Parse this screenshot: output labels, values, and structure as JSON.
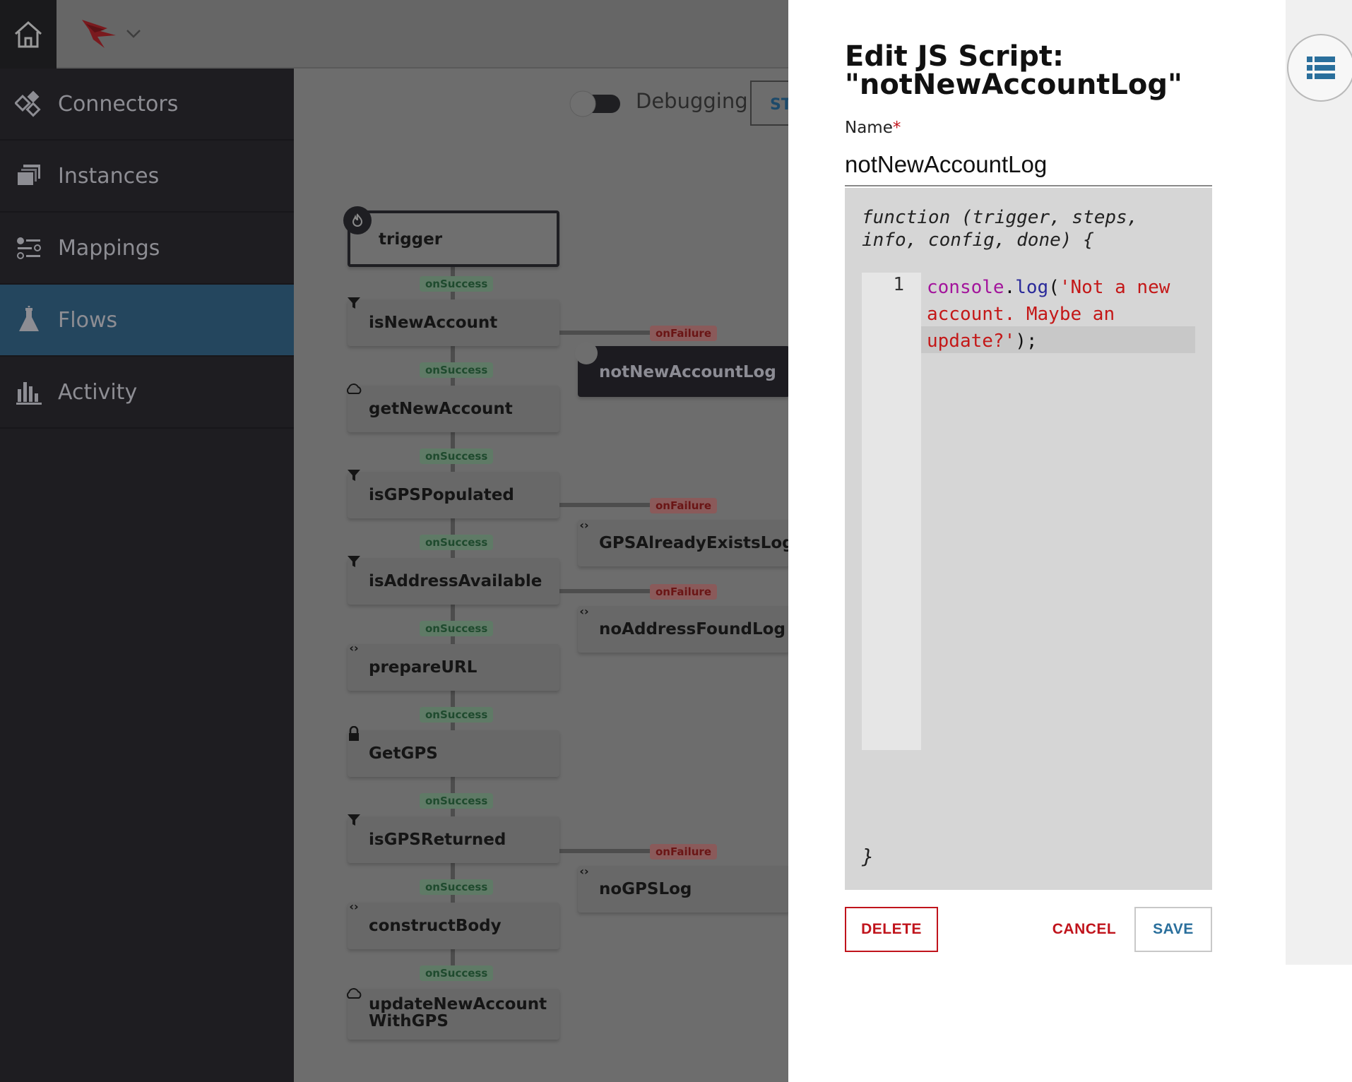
{
  "nav": {
    "items": [
      {
        "label": "Connectors",
        "icon": "connectors-icon"
      },
      {
        "label": "Instances",
        "icon": "instances-icon"
      },
      {
        "label": "Mappings",
        "icon": "mappings-icon"
      },
      {
        "label": "Flows",
        "icon": "flask-icon",
        "active": true
      },
      {
        "label": "Activity",
        "icon": "bar-chart-icon"
      }
    ]
  },
  "toolbar": {
    "debug_label": "Debugging",
    "start_label": "ST"
  },
  "flow": {
    "trigger": "trigger",
    "steps": [
      "isNewAccount",
      "getNewAccount",
      "isGPSPopulated",
      "isAddressAvailable",
      "prepareURL",
      "GetGPS",
      "isGPSReturned",
      "constructBody",
      "updateNewAccountWithGPS"
    ],
    "failure_steps": [
      "notNewAccountLog",
      "GPSAlreadyExistsLog",
      "noAddressFoundLog",
      "noGPSLog"
    ],
    "success_label": "onSuccess",
    "failure_label": "onFailure"
  },
  "panel": {
    "title": "Edit JS Script: \"notNewAccountLog\"",
    "name_label": "Name",
    "required_marker": "*",
    "name_value": "notNewAccountLog",
    "fn_signature": "function (trigger, steps, info, config, done) {",
    "line_number": "1",
    "code": {
      "obj": "console",
      "dot": ".",
      "fn": "log",
      "open": "(",
      "str": "'Not a new account. Maybe an update?'",
      "close": ");"
    },
    "close_brace": "}",
    "delete_label": "DELETE",
    "cancel_label": "CANCEL",
    "save_label": "SAVE"
  },
  "colors": {
    "accent_red": "#c0141c",
    "accent_blue": "#2a6f9c",
    "nav_active": "#24465e"
  }
}
